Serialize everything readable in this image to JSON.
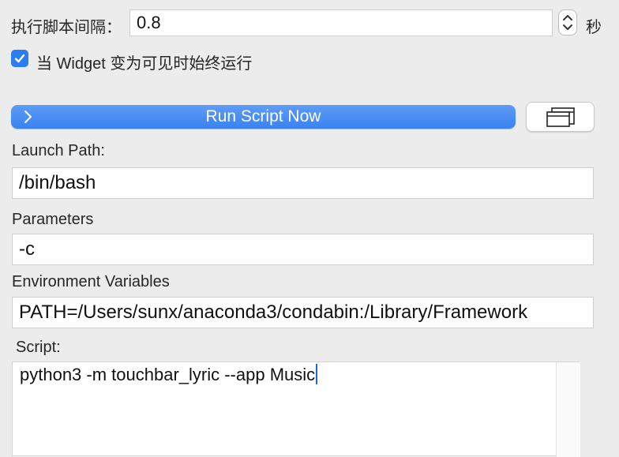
{
  "interval": {
    "label": "执行脚本间隔：",
    "value": "0.8",
    "unit": "秒"
  },
  "run_on_visible": {
    "label": "当 Widget 变为可见时始终运行",
    "checked": true
  },
  "run_button": {
    "label": "Run Script Now",
    "icon": "chevron-right-icon"
  },
  "window_button": {
    "icon": "windows-icon"
  },
  "launch_path": {
    "label": "Launch Path:",
    "value": "/bin/bash"
  },
  "parameters": {
    "label": "Parameters",
    "value": "-c"
  },
  "environment": {
    "label": "Environment Variables",
    "value": "PATH=/Users/sunx/anaconda3/condabin:/Library/Framework"
  },
  "script": {
    "label": "Script:",
    "value": "python3 -m touchbar_lyric --app Music"
  },
  "colors": {
    "accent": "#3a82ef",
    "background": "#ececec"
  }
}
